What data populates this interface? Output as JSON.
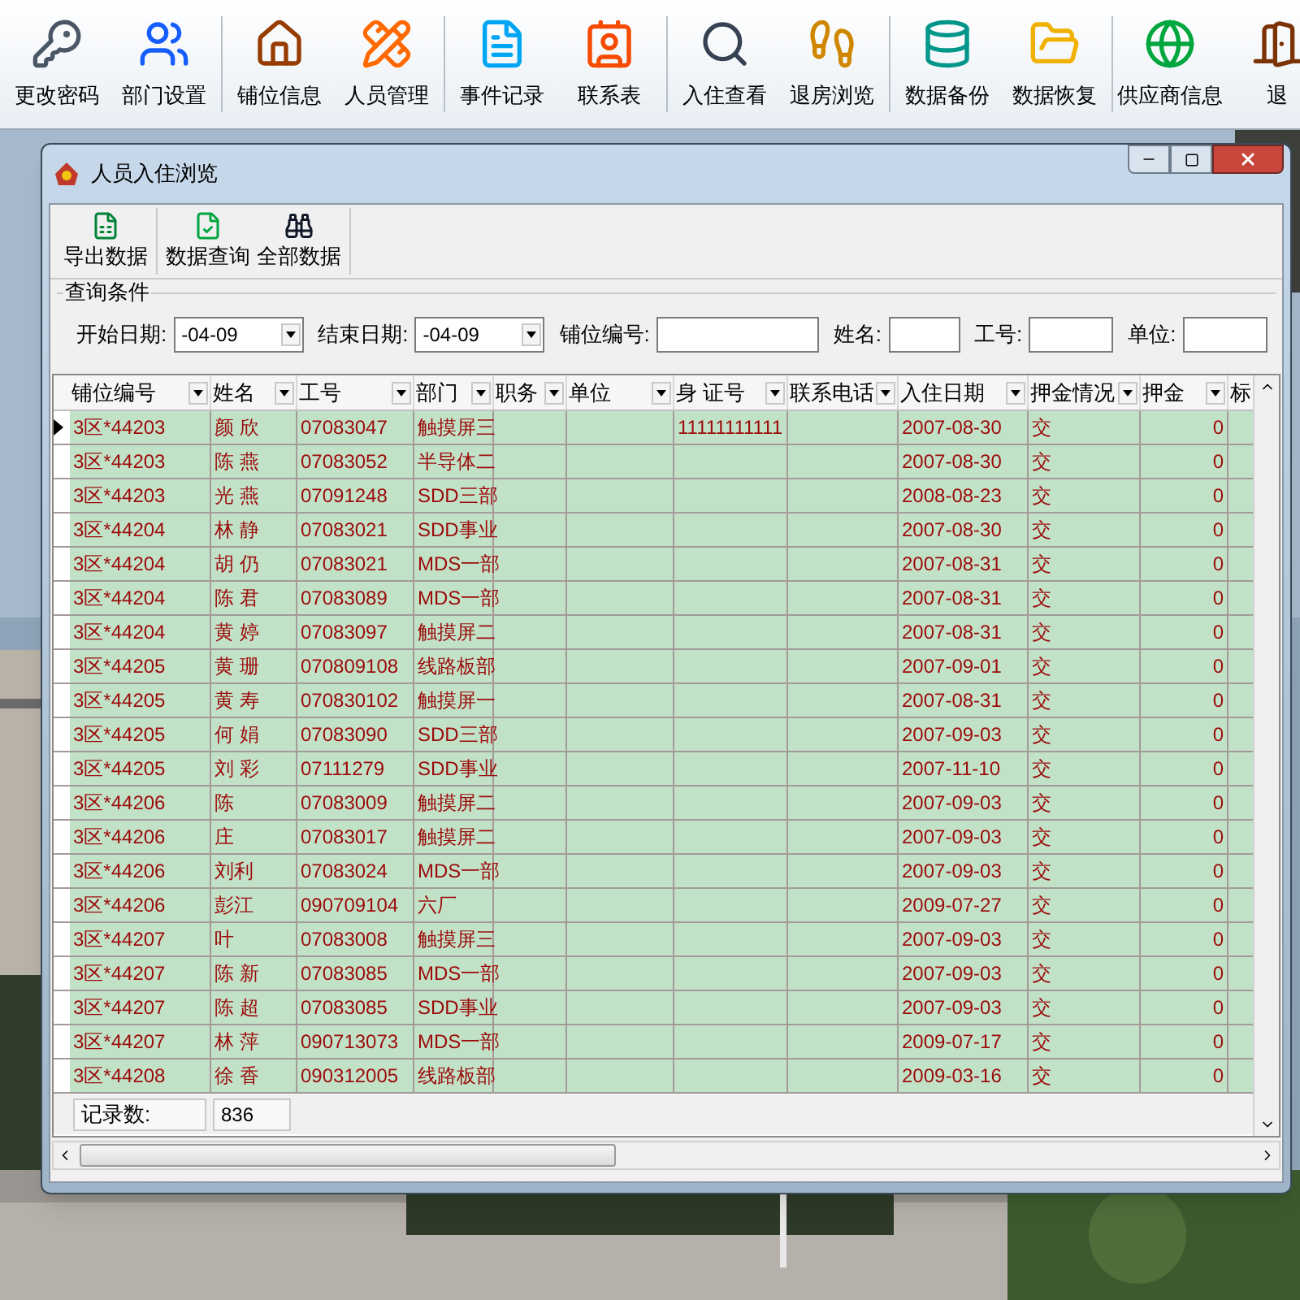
{
  "toolbar": {
    "groups": [
      [
        {
          "label": "更改密码"
        },
        {
          "label": "部门设置"
        }
      ],
      [
        {
          "label": "铺位信息"
        },
        {
          "label": "人员管理"
        }
      ],
      [
        {
          "label": "事件记录"
        },
        {
          "label": "联系表"
        }
      ],
      [
        {
          "label": "入住查看"
        },
        {
          "label": "退房浏览"
        }
      ],
      [
        {
          "label": "数据备份"
        },
        {
          "label": "数据恢复"
        }
      ],
      [
        {
          "label": "供应商信息"
        },
        {
          "label": "退"
        }
      ]
    ]
  },
  "window": {
    "title": "人员入住浏览",
    "toolbar": [
      {
        "label": "导出数据"
      },
      {
        "label": "数据查询"
      },
      {
        "label": "全部数据"
      }
    ],
    "query": {
      "title": "查询条件",
      "fields": [
        {
          "kind": "date",
          "label": "开始日期:",
          "value": "-04-09"
        },
        {
          "kind": "date",
          "label": "结束日期:",
          "value": "-04-09"
        },
        {
          "kind": "text",
          "label": "铺位编号:"
        },
        {
          "kind": "text",
          "label": "姓名:"
        },
        {
          "kind": "text",
          "label": "工号:"
        },
        {
          "kind": "text",
          "label": "单位:"
        }
      ]
    },
    "table": {
      "columns": [
        {
          "label": "铺位编号"
        },
        {
          "label": "姓名"
        },
        {
          "label": "工号"
        },
        {
          "label": "部门"
        },
        {
          "label": "职务"
        },
        {
          "label": "单位"
        },
        {
          "label": "身 证号"
        },
        {
          "label": "联系电话"
        },
        {
          "label": "入住日期"
        },
        {
          "label": "押金情况"
        },
        {
          "label": "押金"
        },
        {
          "label": "标"
        }
      ],
      "rows": [
        {
          "current": true,
          "bed": "3区*44203",
          "name": "颜 欣",
          "emp_no": "07083047",
          "dept": "触摸屏三",
          "id_card": "11111111111",
          "checkin": "2007-08-30",
          "deposit_state": "交",
          "deposit": "0"
        },
        {
          "current": false,
          "bed": "3区*44203",
          "name": "陈 燕",
          "emp_no": "07083052",
          "dept": "半导体二",
          "checkin": "2007-08-30",
          "deposit_state": "交",
          "deposit": "0"
        },
        {
          "current": false,
          "bed": "3区*44203",
          "name": "光 燕",
          "emp_no": "07091248",
          "dept": "SDD三部",
          "checkin": "2008-08-23",
          "deposit_state": "交",
          "deposit": "0"
        },
        {
          "current": false,
          "bed": "3区*44204",
          "name": "林 静",
          "emp_no": "07083021",
          "dept": "SDD事业",
          "checkin": "2007-08-30",
          "deposit_state": "交",
          "deposit": "0"
        },
        {
          "current": false,
          "bed": "3区*44204",
          "name": "胡 仍",
          "emp_no": "07083021",
          "dept": "MDS一部",
          "checkin": "2007-08-31",
          "deposit_state": "交",
          "deposit": "0"
        },
        {
          "current": false,
          "bed": "3区*44204",
          "name": "陈 君",
          "emp_no": "07083089",
          "dept": "MDS一部",
          "checkin": "2007-08-31",
          "deposit_state": "交",
          "deposit": "0"
        },
        {
          "current": false,
          "bed": "3区*44204",
          "name": "黄 婷",
          "emp_no": "07083097",
          "dept": "触摸屏二",
          "checkin": "2007-08-31",
          "deposit_state": "交",
          "deposit": "0"
        },
        {
          "current": false,
          "bed": "3区*44205",
          "name": "黄 珊",
          "emp_no": "070809108",
          "dept": "线路板部",
          "checkin": "2007-09-01",
          "deposit_state": "交",
          "deposit": "0"
        },
        {
          "current": false,
          "bed": "3区*44205",
          "name": "黄 寿",
          "emp_no": "070830102",
          "dept": "触摸屏一",
          "checkin": "2007-08-31",
          "deposit_state": "交",
          "deposit": "0"
        },
        {
          "current": false,
          "bed": "3区*44205",
          "name": "何 娟",
          "emp_no": "07083090",
          "dept": "SDD三部",
          "checkin": "2007-09-03",
          "deposit_state": "交",
          "deposit": "0"
        },
        {
          "current": false,
          "bed": "3区*44205",
          "name": "刘 彩",
          "emp_no": "07111279",
          "dept": "SDD事业",
          "checkin": "2007-11-10",
          "deposit_state": "交",
          "deposit": "0"
        },
        {
          "current": false,
          "bed": "3区*44206",
          "name": "陈",
          "emp_no": "07083009",
          "dept": "触摸屏二",
          "checkin": "2007-09-03",
          "deposit_state": "交",
          "deposit": "0"
        },
        {
          "current": false,
          "bed": "3区*44206",
          "name": "庄",
          "emp_no": "07083017",
          "dept": "触摸屏二",
          "checkin": "2007-09-03",
          "deposit_state": "交",
          "deposit": "0"
        },
        {
          "current": false,
          "bed": "3区*44206",
          "name": "刘利",
          "emp_no": "07083024",
          "dept": "MDS一部",
          "checkin": "2007-09-03",
          "deposit_state": "交",
          "deposit": "0"
        },
        {
          "current": false,
          "bed": "3区*44206",
          "name": "彭江",
          "emp_no": "090709104",
          "dept": "六厂",
          "checkin": "2009-07-27",
          "deposit_state": "交",
          "deposit": "0"
        },
        {
          "current": false,
          "bed": "3区*44207",
          "name": "叶",
          "emp_no": "07083008",
          "dept": "触摸屏三",
          "checkin": "2007-09-03",
          "deposit_state": "交",
          "deposit": "0"
        },
        {
          "current": false,
          "bed": "3区*44207",
          "name": "陈 新",
          "emp_no": "07083085",
          "dept": "MDS一部",
          "checkin": "2007-09-03",
          "deposit_state": "交",
          "deposit": "0"
        },
        {
          "current": false,
          "bed": "3区*44207",
          "name": "陈 超",
          "emp_no": "07083085",
          "dept": "SDD事业",
          "checkin": "2007-09-03",
          "deposit_state": "交",
          "deposit": "0"
        },
        {
          "current": false,
          "bed": "3区*44207",
          "name": "林 萍",
          "emp_no": "090713073",
          "dept": "MDS一部",
          "checkin": "2009-07-17",
          "deposit_state": "交",
          "deposit": "0"
        },
        {
          "current": false,
          "bed": "3区*44208",
          "name": "徐 香",
          "emp_no": "090312005",
          "dept": "线路板部",
          "checkin": "2009-03-16",
          "deposit_state": "交",
          "deposit": "0"
        }
      ]
    },
    "footer": {
      "label": "记录数:",
      "value": "836"
    }
  }
}
